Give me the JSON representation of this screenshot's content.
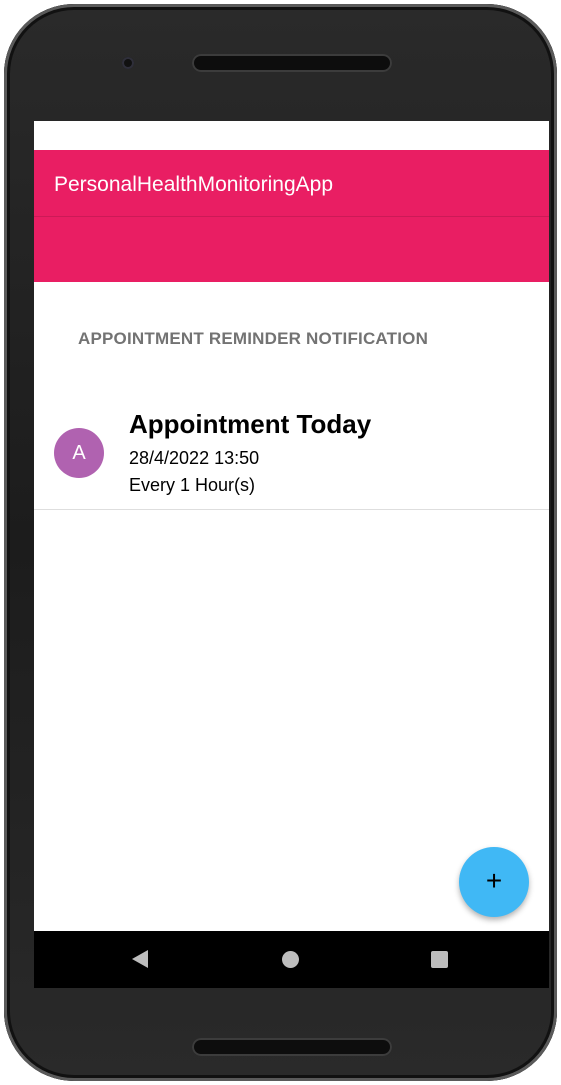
{
  "app_bar": {
    "title": "PersonalHealthMonitoringApp",
    "color": "#e91e63"
  },
  "section": {
    "title": "APPOINTMENT REMINDER NOTIFICATION"
  },
  "reminders": [
    {
      "avatar_letter": "A",
      "avatar_color": "#b062b0",
      "title": "Appointment Today",
      "datetime": "28/4/2022 13:50",
      "repeat": "Every 1 Hour(s)"
    }
  ],
  "fab": {
    "icon": "plus-icon",
    "label": "+",
    "color": "#40b8f5"
  },
  "navigation": {
    "back_icon": "back-triangle-icon",
    "home_icon": "home-circle-icon",
    "recents_icon": "recents-square-icon"
  }
}
